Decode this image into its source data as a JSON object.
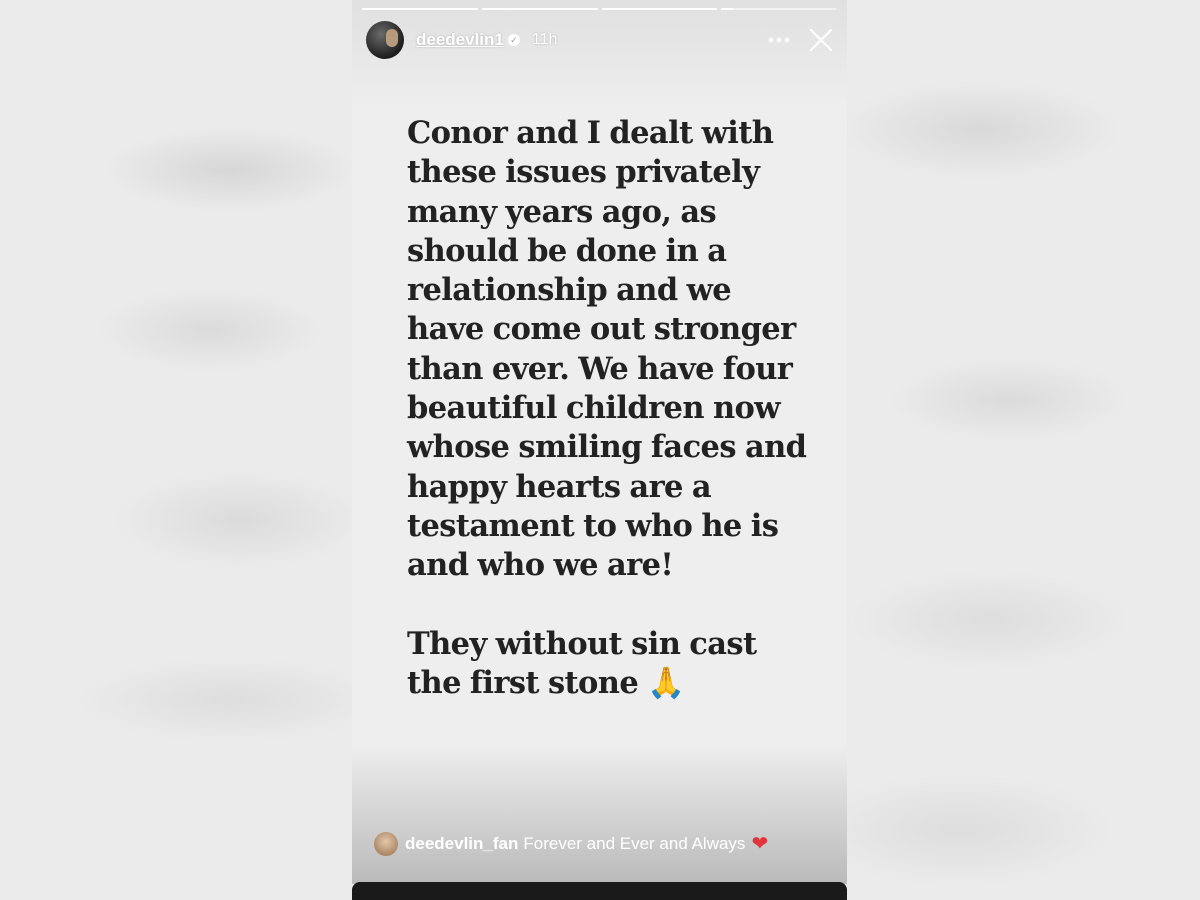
{
  "header": {
    "username": "deedevlin1",
    "time": "11h",
    "more_icon": "more-horizontal-icon",
    "close_icon": "close-icon"
  },
  "progress": {
    "segments": [
      1,
      1,
      1,
      0.1
    ]
  },
  "story": {
    "paragraph_1": "Conor and I dealt with\nthese issues privately\nmany years ago, as\nshould be done in a\nrelationship and we\nhave come out stronger\nthan ever. We have four\nbeautiful children now\nwhose smiling faces and\nhappy hearts are a\ntestament to who he is\nand who we are!",
    "paragraph_2": "They without sin cast\nthe first stone 🙏"
  },
  "mention": {
    "username": "deedevlin_fan",
    "text": "Forever and Ever and Always",
    "emoji": "❤"
  },
  "colors": {
    "text": "#222222",
    "story_bg": "#eeeeee",
    "heart": "#e0343a"
  }
}
